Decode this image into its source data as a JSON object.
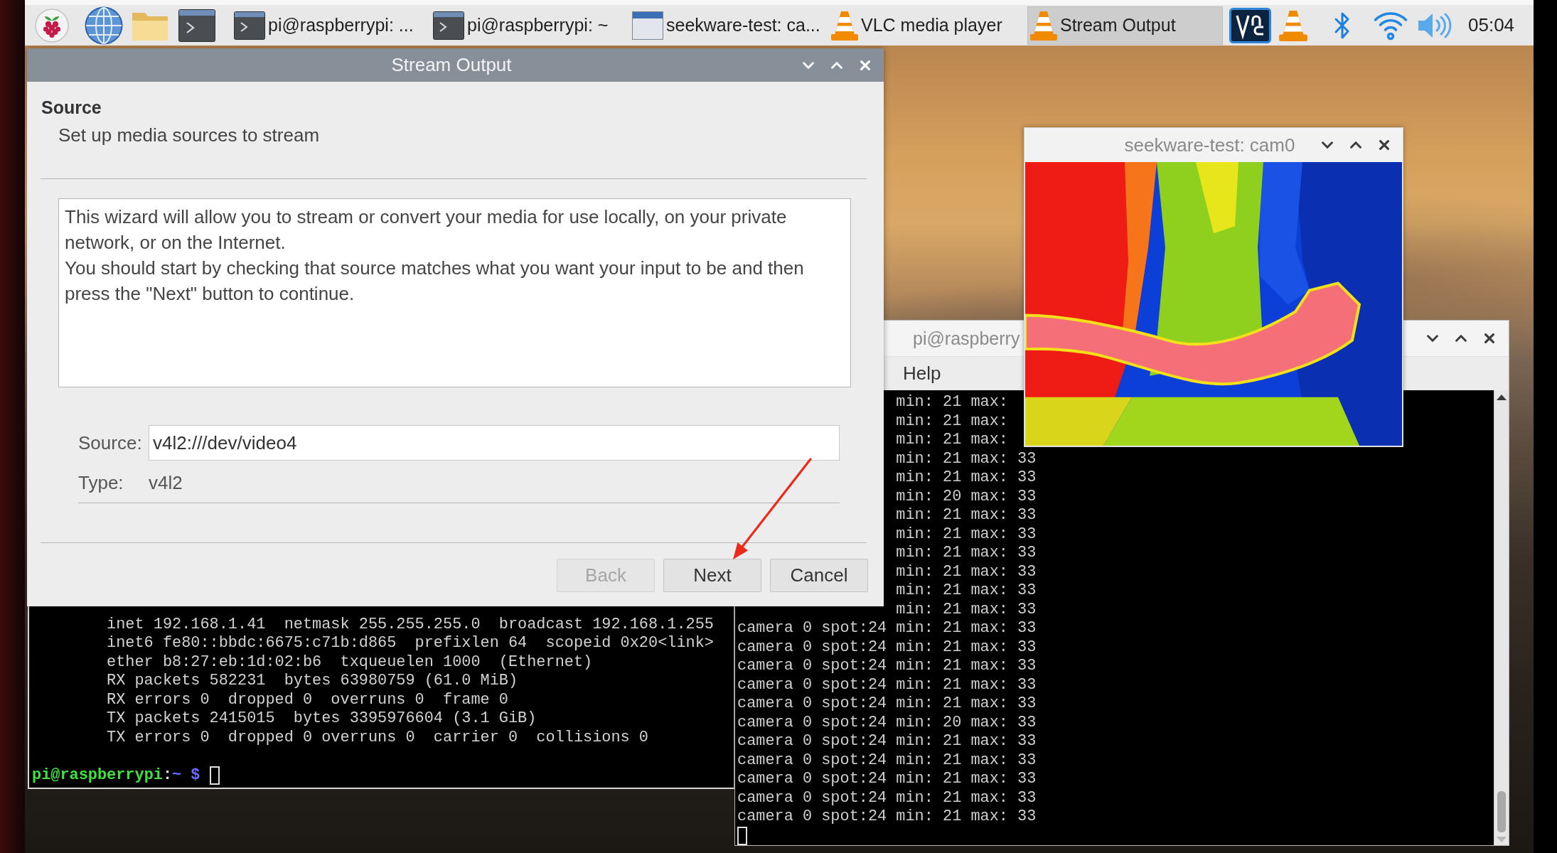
{
  "taskbar": {
    "tasks": [
      {
        "kind": "terminal",
        "label": "pi@raspberrypi: ...",
        "selected": false
      },
      {
        "kind": "terminal",
        "label": "pi@raspberrypi: ~",
        "selected": false
      },
      {
        "kind": "window",
        "label": "seekware-test: ca...",
        "selected": false
      },
      {
        "kind": "vlc",
        "label": "VLC media player",
        "selected": false
      },
      {
        "kind": "vlc",
        "label": "Stream Output",
        "selected": true
      }
    ],
    "clock": "05:04"
  },
  "terminal_left": {
    "interface_details": [
      "inet 192.168.1.41  netmask 255.255.255.0  broadcast 192.168.1.255",
      "inet6 fe80::bbdc:6675:c71b:d865  prefixlen 64  scopeid 0x20<link>",
      "ether b8:27:eb:1d:02:b6  txqueuelen 1000  (Ethernet)",
      "RX packets 582231  bytes 63980759 (61.0 MiB)",
      "RX errors 0  dropped 0  overruns 0  frame 0",
      "TX packets 2415015  bytes 3395976604 (3.1 GiB)",
      "TX errors 0  dropped 0 overruns 0  carrier 0  collisions 0"
    ],
    "prompt": {
      "user_host": "pi@raspberrypi",
      "separator": ":",
      "path": "~",
      "symbol": "$"
    }
  },
  "terminal_right": {
    "title": "pi@raspberry",
    "menu": [
      "Help"
    ],
    "partial_lines": [
      "min: 21 max:",
      "min: 21 max:",
      "min: 21 max:",
      "min: 21 max: 33",
      "min: 21 max: 33",
      "min: 20 max: 33",
      "min: 21 max: 33",
      "min: 21 max: 33",
      "min: 21 max: 33",
      "min: 21 max: 33",
      "min: 21 max: 33",
      "min: 21 max: 33"
    ],
    "lines": [
      "camera 0 spot:24 min: 21 max: 33",
      "camera 0 spot:24 min: 21 max: 33",
      "camera 0 spot:24 min: 21 max: 33",
      "camera 0 spot:24 min: 21 max: 33",
      "camera 0 spot:24 min: 21 max: 33",
      "camera 0 spot:24 min: 20 max: 33",
      "camera 0 spot:24 min: 21 max: 33",
      "camera 0 spot:24 min: 21 max: 33",
      "camera 0 spot:24 min: 21 max: 33",
      "camera 0 spot:24 min: 21 max: 33",
      "camera 0 spot:24 min: 21 max: 33"
    ]
  },
  "camera_window": {
    "title": "seekware-test: cam0"
  },
  "dialog": {
    "title": "Stream Output",
    "heading": "Source",
    "subheading": "Set up media sources to stream",
    "description": [
      "This wizard will allow you to stream or convert your media for use locally, on your private network, or on the Internet.",
      "You should start by checking that source matches what you want your input to be and then press the \"Next\" button to continue."
    ],
    "fields": [
      {
        "kind": "input",
        "label": "Source:",
        "value": "v4l2:///dev/video4"
      },
      {
        "kind": "text",
        "label": "Type:",
        "value": "v4l2"
      }
    ],
    "buttons": [
      {
        "label": "Back",
        "disabled": true
      },
      {
        "label": "Next",
        "disabled": false
      },
      {
        "label": "Cancel",
        "disabled": false
      }
    ]
  }
}
